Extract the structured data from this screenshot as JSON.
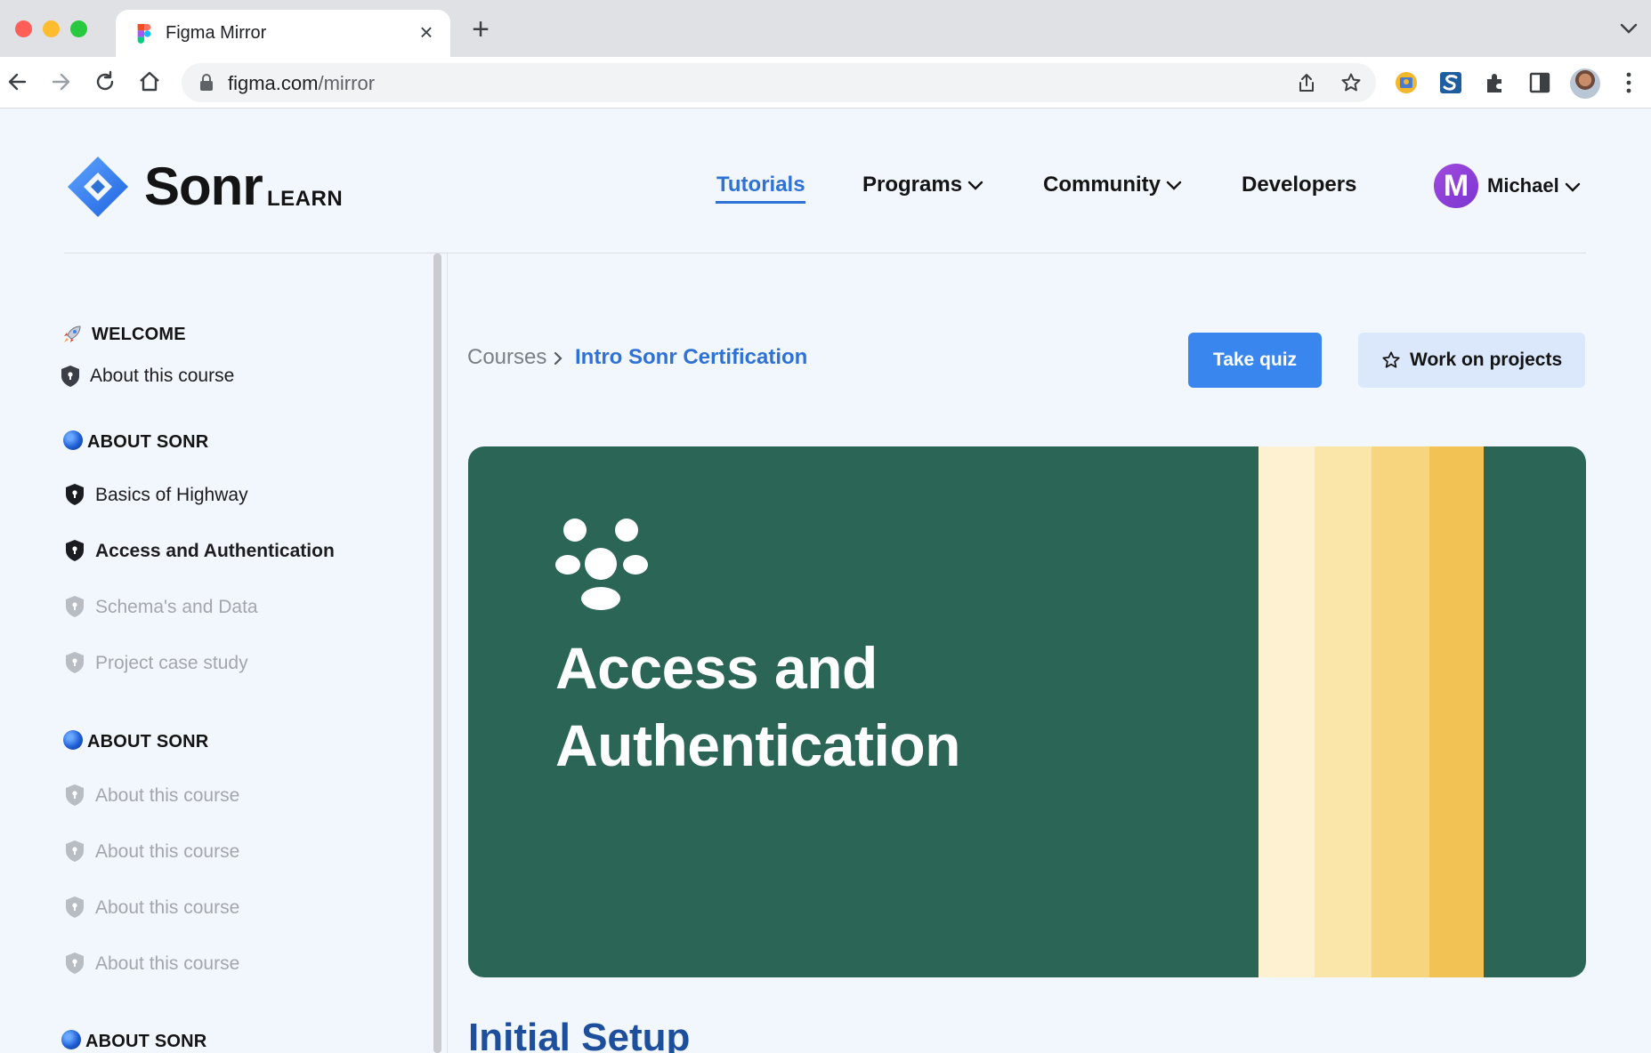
{
  "browser": {
    "tab_title": "Figma Mirror",
    "tab_close": "×",
    "new_tab": "+",
    "url_host": "figma.com",
    "url_path": "/mirror"
  },
  "site": {
    "logo_text": "Sonr",
    "logo_sub": "LEARN",
    "nav": {
      "tutorials": "Tutorials",
      "programs": "Programs",
      "community": "Community",
      "developers": "Developers"
    },
    "user": {
      "initial": "M",
      "name": "Michael"
    }
  },
  "sidebar": {
    "sections": [
      {
        "title": "WELCOME",
        "icon": "rocket-icon"
      },
      {
        "title": "ABOUT SONR",
        "icon": "sphere-icon"
      },
      {
        "title": "ABOUT SONR",
        "icon": "sphere-icon"
      },
      {
        "title": "ABOUT SONR",
        "icon": "sphere-icon"
      }
    ],
    "items": [
      {
        "label": "About this course",
        "state": "normal"
      },
      {
        "label": "Basics of Highway",
        "state": "normal"
      },
      {
        "label": "Access and Authentication",
        "state": "active"
      },
      {
        "label": "Schema's and Data",
        "state": "locked"
      },
      {
        "label": "Project case study",
        "state": "locked"
      },
      {
        "label": "About this course",
        "state": "locked"
      },
      {
        "label": "About this course",
        "state": "locked"
      },
      {
        "label": "About this course",
        "state": "locked"
      },
      {
        "label": "About this course",
        "state": "locked"
      }
    ]
  },
  "main": {
    "breadcrumb": {
      "root": "Courses",
      "current": "Intro Sonr Certification"
    },
    "buttons": {
      "take_quiz": "Take quiz",
      "work_on_projects": "Work on projects"
    },
    "hero": {
      "title": "Access and Authentication",
      "icon": "users-group-icon"
    },
    "section_title": "Initial Setup"
  },
  "colors": {
    "accent_blue": "#2f72d6",
    "primary_button": "#3a86ef",
    "hero_green": "#2b6556",
    "stripes": [
      "#fdf1d2",
      "#fbe6aa",
      "#f7d57e",
      "#f3c255"
    ]
  }
}
